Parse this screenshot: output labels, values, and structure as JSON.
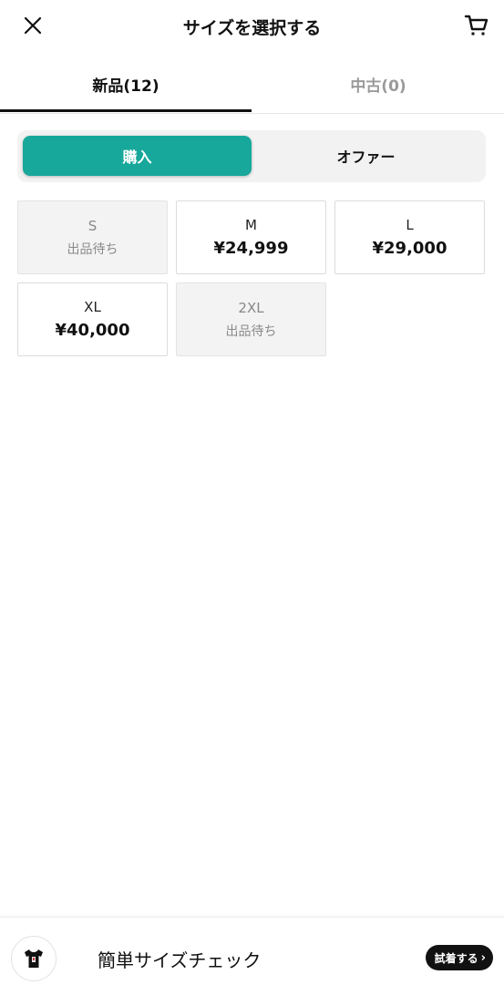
{
  "header": {
    "title": "サイズを選択する",
    "close_icon": "close-icon",
    "cart_icon": "cart-icon"
  },
  "tabs": [
    {
      "label": "新品(12)",
      "active": true
    },
    {
      "label": "中古(0)",
      "active": false
    }
  ],
  "segment": {
    "buy_label": "購入",
    "offer_label": "オファー",
    "accent_color": "#17a89b"
  },
  "sizes": [
    {
      "name": "S",
      "status": "出品待ち",
      "available": false
    },
    {
      "name": "M",
      "price": "¥24,999",
      "available": true
    },
    {
      "name": "L",
      "price": "¥29,000",
      "available": true
    },
    {
      "name": "XL",
      "price": "¥40,000",
      "available": true
    },
    {
      "name": "2XL",
      "status": "出品待ち",
      "available": false
    }
  ],
  "footer": {
    "label": "簡単サイズチェック",
    "try_button": "試着する",
    "thumbnail_icon": "tshirt-icon"
  }
}
